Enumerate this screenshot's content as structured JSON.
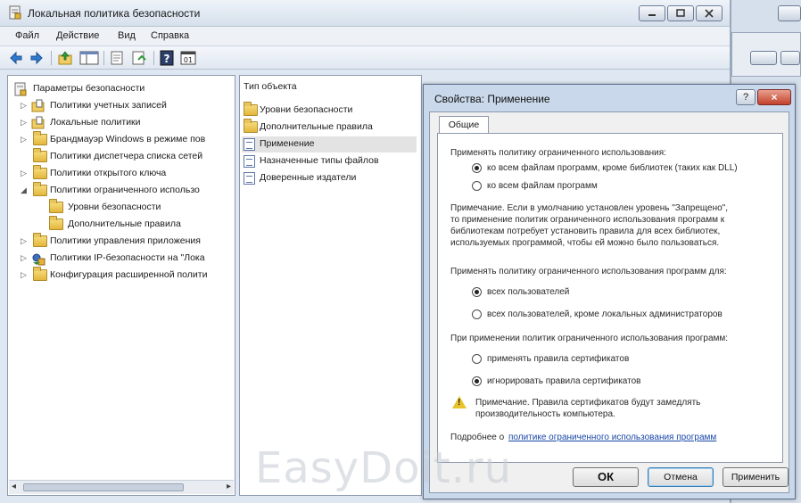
{
  "window": {
    "title": "Локальная политика безопасности"
  },
  "menu": {
    "items": [
      "Файл",
      "Действие",
      "Вид",
      "Справка"
    ]
  },
  "toolbar": {
    "icons": [
      "back-arrow-icon",
      "forward-arrow-icon",
      "up-folder-icon",
      "show-tree-icon",
      "export-list-icon",
      "refresh-icon",
      "help-icon",
      "console-icon"
    ]
  },
  "tree": {
    "items": [
      {
        "label": "Параметры безопасности",
        "expanded": true
      },
      {
        "label": "Политики учетных записей"
      },
      {
        "label": "Локальные политики"
      },
      {
        "label": "Брандмауэр Windows в режиме пов"
      },
      {
        "label": "Политики диспетчера списка сетей"
      },
      {
        "label": "Политики открытого ключа"
      },
      {
        "label": "Политики ограниченного использо",
        "expanded": true
      },
      {
        "label": "Уровни безопасности"
      },
      {
        "label": "Дополнительные правила"
      },
      {
        "label": "Политики управления приложения"
      },
      {
        "label": "Политики IP-безопасности на \"Лока"
      },
      {
        "label": "Конфигурация расширенной полити"
      }
    ]
  },
  "list": {
    "header": "Тип объекта",
    "items": [
      {
        "label": "Уровни безопасности"
      },
      {
        "label": "Дополнительные правила"
      },
      {
        "label": "Применение"
      },
      {
        "label": "Назначенные типы файлов"
      },
      {
        "label": "Доверенные издатели"
      }
    ]
  },
  "dialog": {
    "title": "Свойства: Применение",
    "help_button": "?",
    "close_button": "×",
    "tab": "Общие",
    "section1_label": "Применять политику ограниченного использования:",
    "s1_option1": "ко всем файлам программ, кроме библиотек (таких как DLL)",
    "s1_option2": "ко всем файлам программ",
    "note_line1": "Примечание. Если в умолчанию установлен уровень \"Запрещено\",",
    "note_line2": "то применение политик ограниченного использования программ к",
    "note_line3": "библиотекам потребует установить правила для всех библиотек,",
    "note_line4": "используемых программой, чтобы ей можно было пользоваться.",
    "section2_label": "Применять политику ограниченного использования программ для:",
    "s2_option1": "всех пользователей",
    "s2_option2": "всех пользователей, кроме локальных администраторов",
    "section3_label": "При применении политик ограниченного использования программ:",
    "s3_option1": "применять правила сертификатов",
    "s3_option2": "игнорировать правила сертификатов",
    "warning_line1": "Примечание. Правила сертификатов будут замедлять",
    "warning_line2": "производительность компьютера.",
    "more_prefix": "Подробнее о",
    "more_link": "политике ограниченного использования программ",
    "ok_button": "ОК",
    "cancel_button": "Отмена",
    "apply_button": "Применить"
  },
  "watermark": "EasyDoit.ru"
}
